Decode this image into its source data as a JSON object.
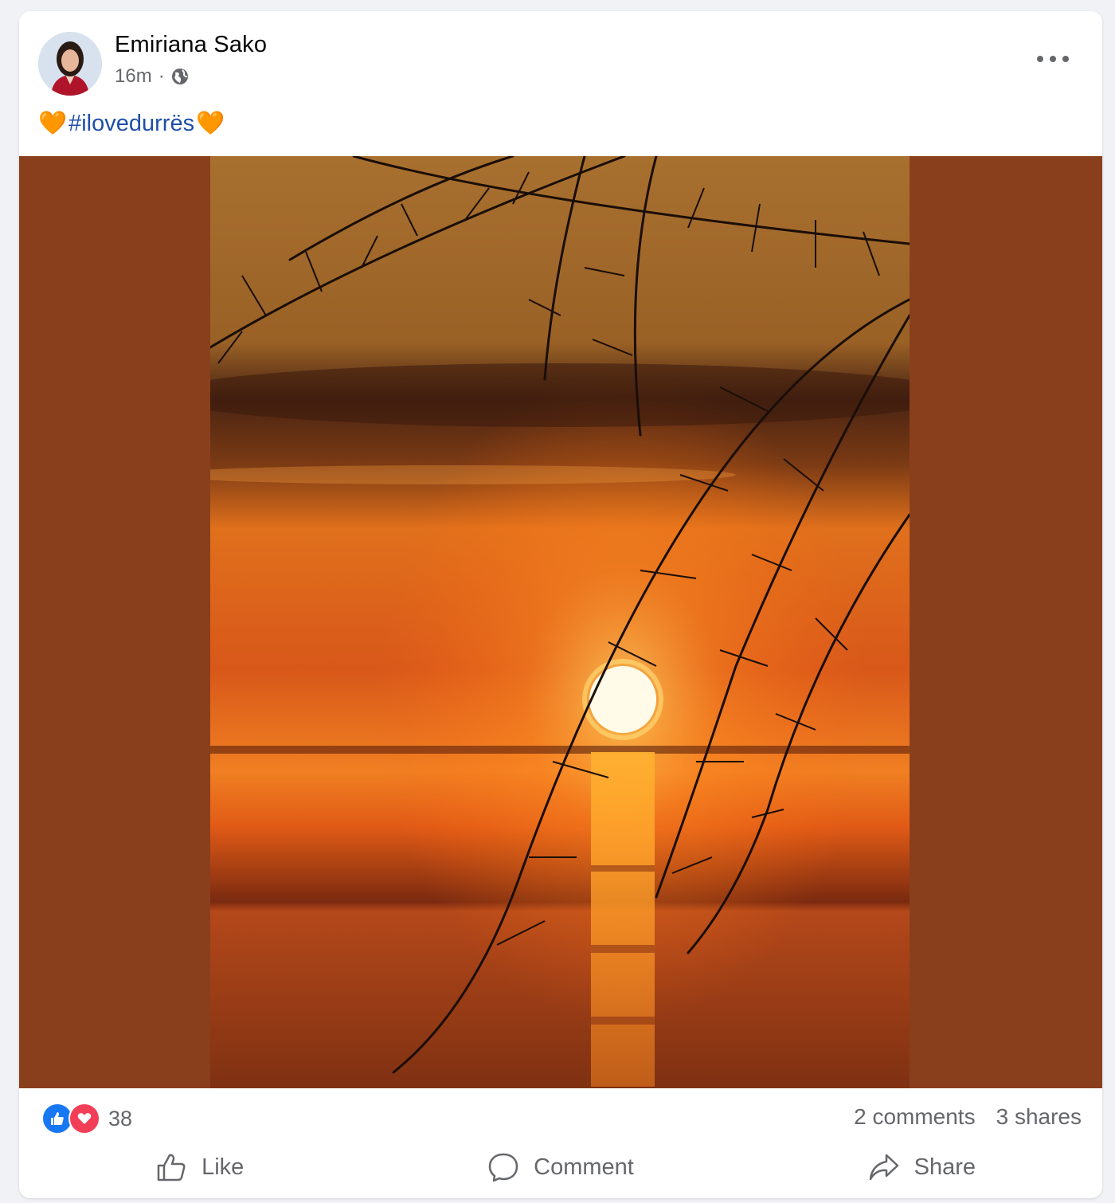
{
  "post": {
    "author": "Emiriana Sako",
    "time": "16m",
    "separator": "·",
    "audience_icon": "globe-icon",
    "caption": {
      "emoji_left": "🧡",
      "hashtag": "#ilovedurrës",
      "emoji_right": "🧡"
    }
  },
  "stats": {
    "reaction_icons": [
      "like-reaction-icon",
      "love-reaction-icon"
    ],
    "reaction_count": "38",
    "comments": "2 comments",
    "shares": "3 shares"
  },
  "actions": {
    "like": "Like",
    "comment": "Comment",
    "share": "Share"
  },
  "colors": {
    "like_blue": "#1877f2",
    "love_red": "#f33e58",
    "hashtag_blue": "#1f4fa8",
    "media_side_background": "#8a3f1c"
  }
}
